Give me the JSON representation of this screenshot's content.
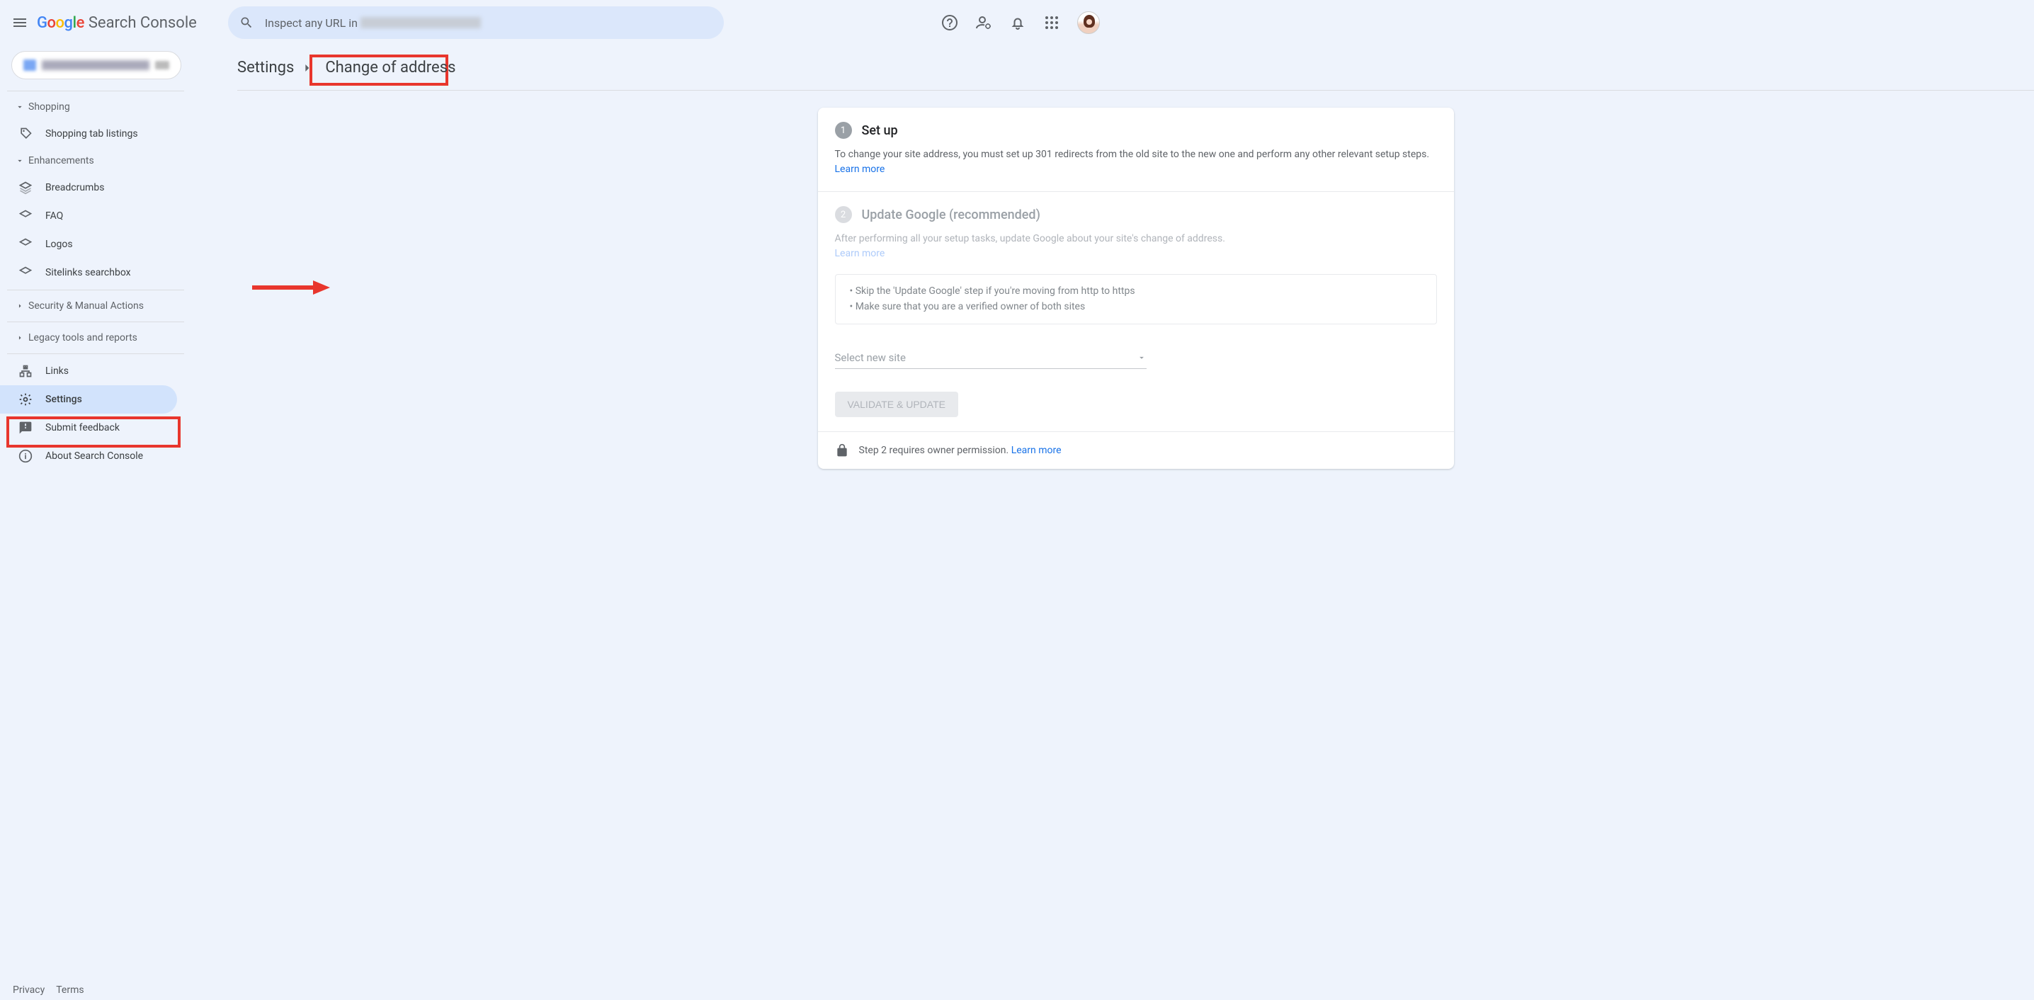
{
  "header": {
    "product": "Search Console",
    "search_placeholder": "Inspect any URL in"
  },
  "breadcrumb": {
    "parent": "Settings",
    "current": "Change of address"
  },
  "sidebar": {
    "sections": {
      "shopping": {
        "title": "Shopping",
        "items": [
          "Shopping tab listings"
        ]
      },
      "enhancements": {
        "title": "Enhancements",
        "items": [
          "Breadcrumbs",
          "FAQ",
          "Logos",
          "Sitelinks searchbox"
        ]
      },
      "security": {
        "title": "Security & Manual Actions"
      },
      "legacy": {
        "title": "Legacy tools and reports"
      }
    },
    "links": "Links",
    "settings": "Settings",
    "feedback": "Submit feedback",
    "about": "About Search Console"
  },
  "card": {
    "step1": {
      "num": "1",
      "title": "Set up",
      "desc": "To change your site address, you must set up 301 redirects from the old site to the new one and perform any other relevant setup steps.",
      "learn": "Learn more"
    },
    "step2": {
      "num": "2",
      "title": "Update Google (recommended)",
      "desc": "After performing all your setup tasks, update Google about your site's change of address.",
      "learn": "Learn more",
      "tip1": "• Skip the 'Update Google' step if you're moving from http to https",
      "tip2": "• Make sure that you are a verified owner of both sites",
      "dropdown": "Select new site",
      "button": "VALIDATE & UPDATE"
    },
    "footer": {
      "text": "Step 2 requires owner permission.",
      "learn": "Learn more"
    }
  },
  "footer": {
    "privacy": "Privacy",
    "terms": "Terms"
  }
}
